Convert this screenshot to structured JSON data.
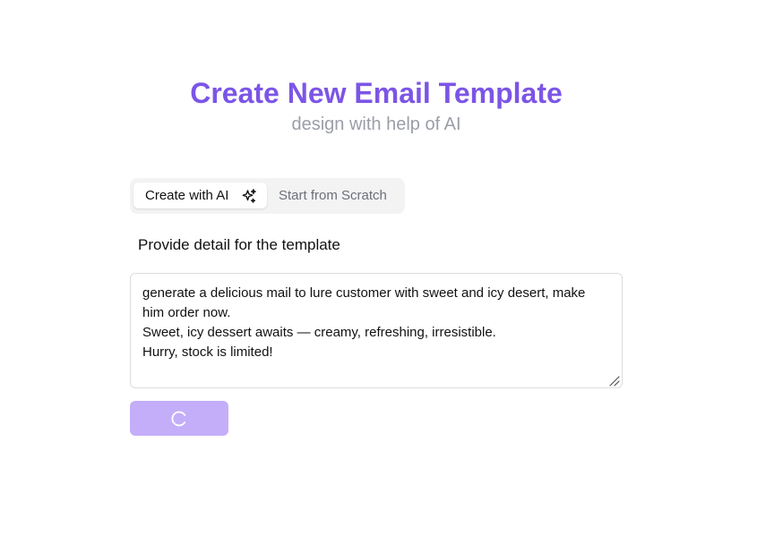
{
  "header": {
    "title": "Create New Email Template",
    "subtitle": "design with help of AI"
  },
  "tabs": [
    {
      "label": "Create with AI",
      "active": true,
      "icon": "sparkles-icon"
    },
    {
      "label": "Start from Scratch",
      "active": false
    }
  ],
  "form": {
    "label": "Provide detail for the template",
    "textarea_value": "generate a delicious mail to lure customer with sweet and icy desert, make him order now.\nSweet, icy dessert awaits — creamy, refreshing, irresistible.\nHurry, stock is limited!",
    "submit_state": "loading",
    "submit_icon": "spinner-icon"
  },
  "colors": {
    "accent": "#7c55e6",
    "button_loading": "#c4aefa",
    "subtitle": "#9a9ea8",
    "tab_bg": "#f3f3f4"
  }
}
